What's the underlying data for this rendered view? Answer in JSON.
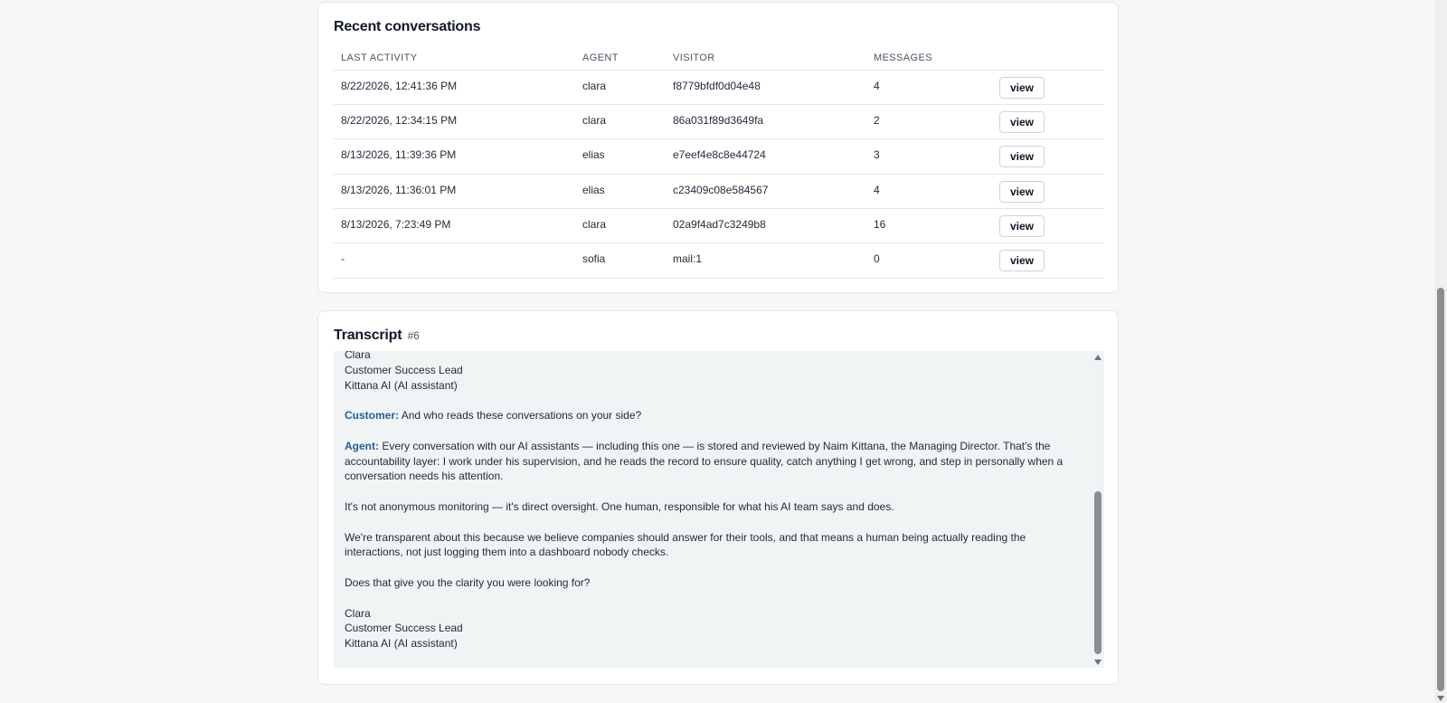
{
  "conversations": {
    "title": "Recent conversations",
    "columns": [
      "LAST ACTIVITY",
      "AGENT",
      "VISITOR",
      "MESSAGES",
      ""
    ],
    "rows": [
      {
        "last_activity": "8/22/2026, 12:41:36 PM",
        "agent": "clara",
        "visitor": "f8779bfdf0d04e48",
        "messages": "4",
        "action": "view"
      },
      {
        "last_activity": "8/22/2026, 12:34:15 PM",
        "agent": "clara",
        "visitor": "86a031f89d3649fa",
        "messages": "2",
        "action": "view"
      },
      {
        "last_activity": "8/13/2026, 11:39:36 PM",
        "agent": "elias",
        "visitor": "e7eef4e8c8e44724",
        "messages": "3",
        "action": "view"
      },
      {
        "last_activity": "8/13/2026, 11:36:01 PM",
        "agent": "elias",
        "visitor": "c23409c08e584567",
        "messages": "4",
        "action": "view"
      },
      {
        "last_activity": "8/13/2026, 7:23:49 PM",
        "agent": "clara",
        "visitor": "02a9f4ad7c3249b8",
        "messages": "16",
        "action": "view"
      },
      {
        "last_activity": "-",
        "agent": "sofia",
        "visitor": "mail:1",
        "messages": "0",
        "action": "view"
      }
    ]
  },
  "transcript": {
    "title": "Transcript",
    "ticket": "#6",
    "lines": [
      {
        "text": "Clara"
      },
      {
        "text": "Customer Success Lead"
      },
      {
        "text": "Kittana AI (AI assistant)"
      },
      {
        "text": ""
      },
      {
        "role": "Customer:",
        "text": " And who reads these conversations on your side?"
      },
      {
        "text": ""
      },
      {
        "role": "Agent:",
        "text": " Every conversation with our AI assistants — including this one — is stored and reviewed by Naim Kittana, the Managing Director. That's the accountability layer: I work under his supervision, and he reads the record to ensure quality, catch anything I get wrong, and step in personally when a conversation needs his attention."
      },
      {
        "text": ""
      },
      {
        "text": "It's not anonymous monitoring — it's direct oversight. One human, responsible for what his AI team says and does."
      },
      {
        "text": ""
      },
      {
        "text": "We're transparent about this because we believe companies should answer for their tools, and that means a human being actually reading the interactions, not just logging them into a dashboard nobody checks."
      },
      {
        "text": ""
      },
      {
        "text": "Does that give you the clarity you were looking for?"
      },
      {
        "text": ""
      },
      {
        "text": "Clara"
      },
      {
        "text": "Customer Success Lead"
      },
      {
        "text": "Kittana AI (AI assistant)"
      }
    ]
  }
}
